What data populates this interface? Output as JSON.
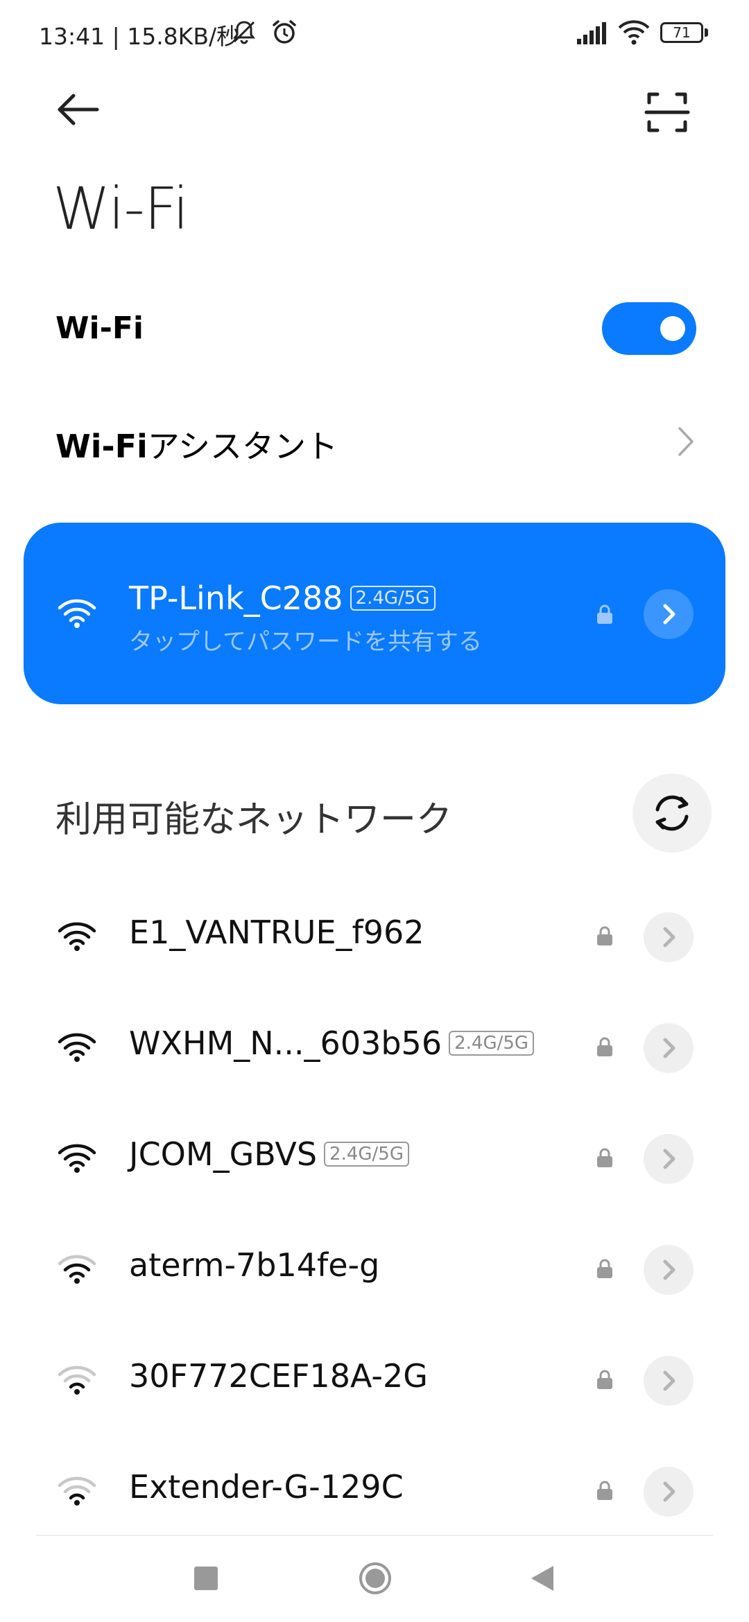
{
  "status_bar": {
    "time_speed": "13:41 | 15.8KB/秒",
    "battery": "71"
  },
  "header": {
    "title": "Wi-Fi"
  },
  "wifi_toggle": {
    "label": "Wi-Fi",
    "enabled": true
  },
  "assistant": {
    "label_bold": "Wi-Fi",
    "label_rest": "アシスタント"
  },
  "connected": {
    "name": "TP-Link_C288",
    "badge": "2.4G/5G",
    "subtitle": "タップしてパスワードを共有する"
  },
  "available": {
    "heading": "利用可能なネットワーク",
    "networks": [
      {
        "name": "E1_VANTRUE_f962",
        "badge": "",
        "signal": 4
      },
      {
        "name": "WXHM_N..._603b56",
        "badge": "2.4G/5G",
        "signal": 4
      },
      {
        "name": "JCOM_GBVS",
        "badge": "2.4G/5G",
        "signal": 4
      },
      {
        "name": "aterm-7b14fe-g",
        "badge": "",
        "signal": 3
      },
      {
        "name": "30F772CEF18A-2G",
        "badge": "",
        "signal": 2
      },
      {
        "name": "Extender-G-129C",
        "badge": "",
        "signal": 2
      }
    ]
  },
  "colors": {
    "accent": "#0a7aff"
  }
}
